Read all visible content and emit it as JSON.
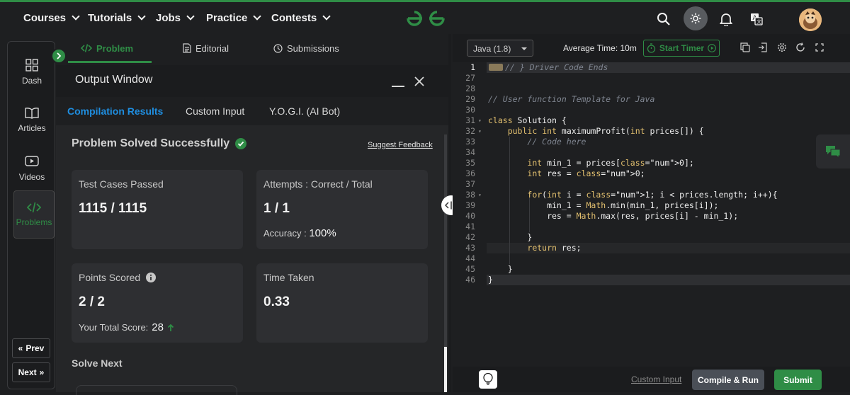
{
  "nav": {
    "items": [
      {
        "label": "Courses"
      },
      {
        "label": "Tutorials"
      },
      {
        "label": "Jobs"
      },
      {
        "label": "Practice"
      },
      {
        "label": "Contests"
      }
    ]
  },
  "rail": {
    "items": [
      {
        "label": "Dash",
        "icon": "grid-icon"
      },
      {
        "label": "Articles",
        "icon": "book-icon"
      },
      {
        "label": "Videos",
        "icon": "video-icon"
      },
      {
        "label": "Problems",
        "icon": "code-icon"
      }
    ],
    "prev_label": "Prev",
    "next_label": "Next"
  },
  "problem_tabs": [
    {
      "label": "Problem"
    },
    {
      "label": "Editorial"
    },
    {
      "label": "Submissions"
    }
  ],
  "output": {
    "title": "Output Window",
    "tabs": [
      {
        "label": "Compilation Results"
      },
      {
        "label": "Custom Input"
      },
      {
        "label": "Y.O.G.I. (AI Bot)"
      }
    ],
    "status": "Problem Solved Successfully",
    "feedback": "Suggest Feedback",
    "cards": {
      "test_cases_label": "Test Cases Passed",
      "test_cases_value": "1115 / 1115",
      "attempts_label": "Attempts : Correct / Total",
      "attempts_value": "1 / 1",
      "accuracy_label": "Accuracy :",
      "accuracy_value": "100%",
      "points_label": "Points Scored",
      "points_value": "2 / 2",
      "total_score_label": "Your Total Score:",
      "total_score_value": "28",
      "time_label": "Time Taken",
      "time_value": "0.33"
    },
    "solve_next": "Solve Next"
  },
  "editor": {
    "language": "Java (1.8)",
    "average_time": "Average Time: 10m",
    "timer_label": "Start Timer",
    "lines": [
      {
        "n": "1",
        "text": "// } Driver Code Ends"
      },
      {
        "n": "27",
        "text": ""
      },
      {
        "n": "28",
        "text": ""
      },
      {
        "n": "29",
        "text": "// User function Template for Java"
      },
      {
        "n": "30",
        "text": ""
      },
      {
        "n": "31",
        "text": "class Solution {"
      },
      {
        "n": "32",
        "text": "    public int maximumProfit(int prices[]) {"
      },
      {
        "n": "33",
        "text": "        // Code here"
      },
      {
        "n": "34",
        "text": ""
      },
      {
        "n": "35",
        "text": "        int min_1 = prices[0];"
      },
      {
        "n": "36",
        "text": "        int res = 0;"
      },
      {
        "n": "37",
        "text": ""
      },
      {
        "n": "38",
        "text": "        for(int i = 1; i < prices.length; i++){"
      },
      {
        "n": "39",
        "text": "            min_1 = Math.min(min_1, prices[i]);"
      },
      {
        "n": "40",
        "text": "            res = Math.max(res, prices[i] - min_1);"
      },
      {
        "n": "41",
        "text": ""
      },
      {
        "n": "42",
        "text": "        }"
      },
      {
        "n": "43",
        "text": "        return res;"
      },
      {
        "n": "44",
        "text": ""
      },
      {
        "n": "45",
        "text": "    }"
      },
      {
        "n": "46",
        "text": "}"
      }
    ],
    "custom_input": "Custom Input",
    "compile_run": "Compile & Run",
    "submit": "Submit"
  },
  "colors": {
    "brand_green": "#2f8d46",
    "active_blue": "#1f8ee0"
  }
}
